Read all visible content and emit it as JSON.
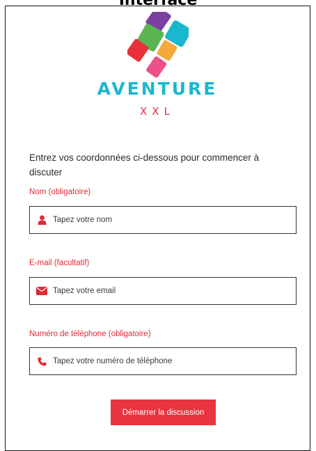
{
  "header": {
    "title": "Interface"
  },
  "brand": {
    "name": "AVENTURE",
    "sub": "XXL",
    "colors": {
      "cyan": "#19b8cf",
      "red": "#e8303d",
      "purple": "#7b3fa0",
      "green": "#5ab552",
      "orange": "#f5a93b",
      "pink": "#ec4f8a"
    }
  },
  "form": {
    "intro": "Entrez vos coordonnées ci-dessous pour commencer à discuter",
    "fields": [
      {
        "label": "Nom (obligatoire)",
        "placeholder": "Tapez votre nom",
        "icon": "user-icon",
        "value": ""
      },
      {
        "label": "E-mail (facultatif)",
        "placeholder": "Tapez votre email",
        "icon": "envelope-icon",
        "value": ""
      },
      {
        "label": "Numéro de téléphone (obligatoire)",
        "placeholder": "Tapez votre numéro de téléphone",
        "icon": "phone-icon",
        "value": ""
      }
    ],
    "submit_label": "Démarrer la discussion",
    "accent_color": "#e8343f"
  }
}
